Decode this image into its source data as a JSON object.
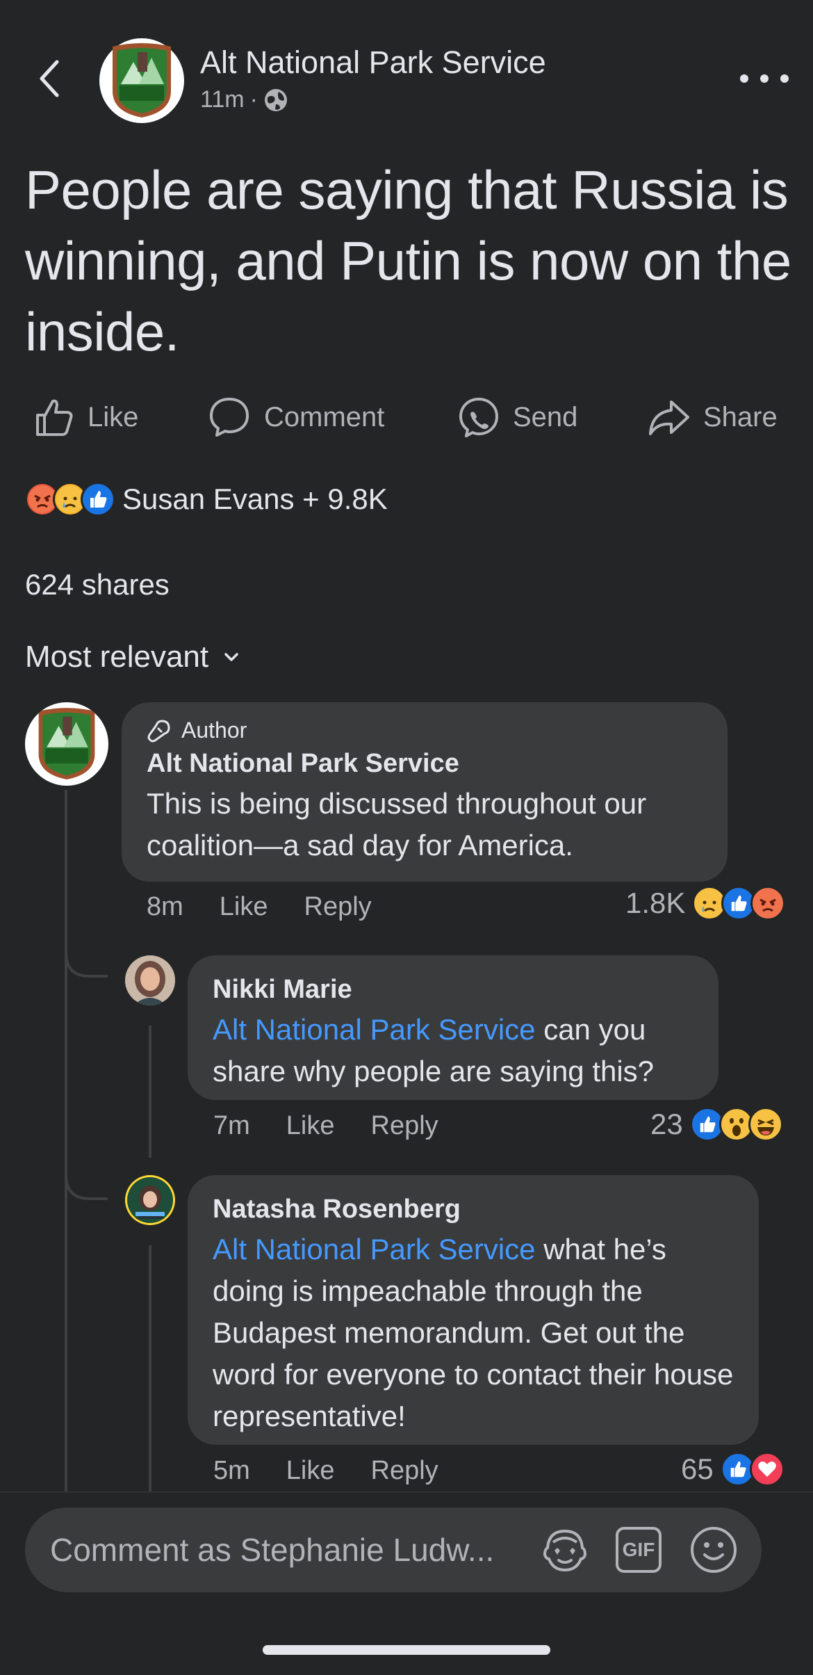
{
  "header": {
    "page_name": "Alt National Park Service",
    "time": "11m",
    "separator": "·"
  },
  "post": {
    "text": "People are saying that Russia is winning, and Putin is now on the inside."
  },
  "actions": {
    "like": "Like",
    "comment": "Comment",
    "send": "Send",
    "share": "Share"
  },
  "reactions": {
    "summary": "Susan Evans + 9.8K",
    "icons": [
      "angry",
      "sad",
      "like"
    ]
  },
  "shares": "624 shares",
  "sort": {
    "label": "Most relevant"
  },
  "comments": [
    {
      "badge": "Author",
      "author": "Alt National Park Service",
      "text": "This is being discussed throughout our coalition—a sad day for America.",
      "time": "8m",
      "like": "Like",
      "reply": "Reply",
      "count": "1.8K",
      "reactions": [
        "sad",
        "like",
        "angry"
      ]
    },
    {
      "author": "Nikki Marie",
      "mention": "Alt National Park Service",
      "text": " can you share why people are saying this?",
      "time": "7m",
      "like": "Like",
      "reply": "Reply",
      "count": "23",
      "reactions": [
        "like",
        "wow",
        "haha"
      ]
    },
    {
      "author": "Natasha Rosenberg",
      "mention": "Alt National Park Service",
      "text": " what he’s doing is impeachable through the Budapest memorandum. Get out the word for everyone to contact their house representative!",
      "time": "5m",
      "like": "Like",
      "reply": "Reply",
      "count": "65",
      "reactions": [
        "like",
        "love"
      ]
    }
  ],
  "composer": {
    "placeholder": "Comment as Stephanie Ludw...",
    "gif_label": "GIF"
  },
  "colors": {
    "background": "#242526",
    "bubble": "#3a3b3c",
    "mention": "#4599ff",
    "like_blue": "#1b74e4",
    "angry": "#e9563e",
    "sad_yellow": "#f7b125",
    "love_red": "#f33e58"
  }
}
